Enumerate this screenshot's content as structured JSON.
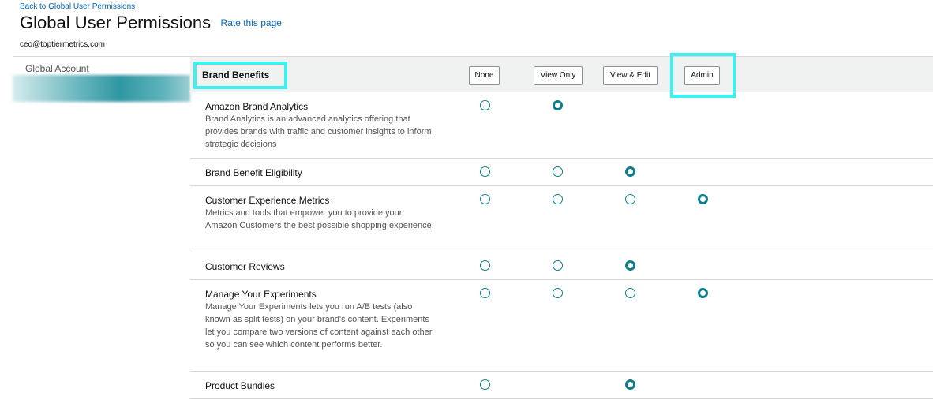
{
  "nav": {
    "back_link": "Back to Global User Permissions"
  },
  "header": {
    "title": "Global User Permissions",
    "rate_link": "Rate this page",
    "account_email": "ceo@toptiermetrics.com"
  },
  "sidebar": {
    "items": [
      {
        "label": "Global Account"
      }
    ]
  },
  "section": {
    "title": "Brand Benefits",
    "columns": [
      {
        "key": "none",
        "label": "None"
      },
      {
        "key": "view",
        "label": "View Only"
      },
      {
        "key": "edit",
        "label": "View & Edit"
      },
      {
        "key": "admin",
        "label": "Admin"
      }
    ]
  },
  "rows": [
    {
      "name": "Amazon Brand Analytics",
      "description": "Brand Analytics is an advanced analytics offering that provides brands with traffic and customer insights to inform strategic decisions",
      "options": [
        "none",
        "view"
      ],
      "selected": "view"
    },
    {
      "name": "Brand Benefit Eligibility",
      "description": "",
      "options": [
        "none",
        "view",
        "edit"
      ],
      "selected": "edit"
    },
    {
      "name": "Customer Experience Metrics",
      "description": "Metrics and tools that empower you to provide your Amazon Customers the best possible shopping experience.",
      "options": [
        "none",
        "view",
        "edit",
        "admin"
      ],
      "selected": "admin"
    },
    {
      "name": "Customer Reviews",
      "description": "",
      "options": [
        "none",
        "view",
        "edit"
      ],
      "selected": "edit"
    },
    {
      "name": "Manage Your Experiments",
      "description": "Manage Your Experiments lets you run A/B tests (also known as split tests) on your brand's content. Experiments let you compare two versions of content against each other so you can see which content performs better.",
      "options": [
        "none",
        "view",
        "edit",
        "admin"
      ],
      "selected": "admin"
    },
    {
      "name": "Product Bundles",
      "description": "",
      "options": [
        "none",
        "edit"
      ],
      "selected": "edit"
    }
  ],
  "colors": {
    "link": "#0066c0",
    "radio_accent": "#0a7f8b",
    "highlight": "#3ef0f0",
    "header_bg": "#f0f2f2"
  }
}
